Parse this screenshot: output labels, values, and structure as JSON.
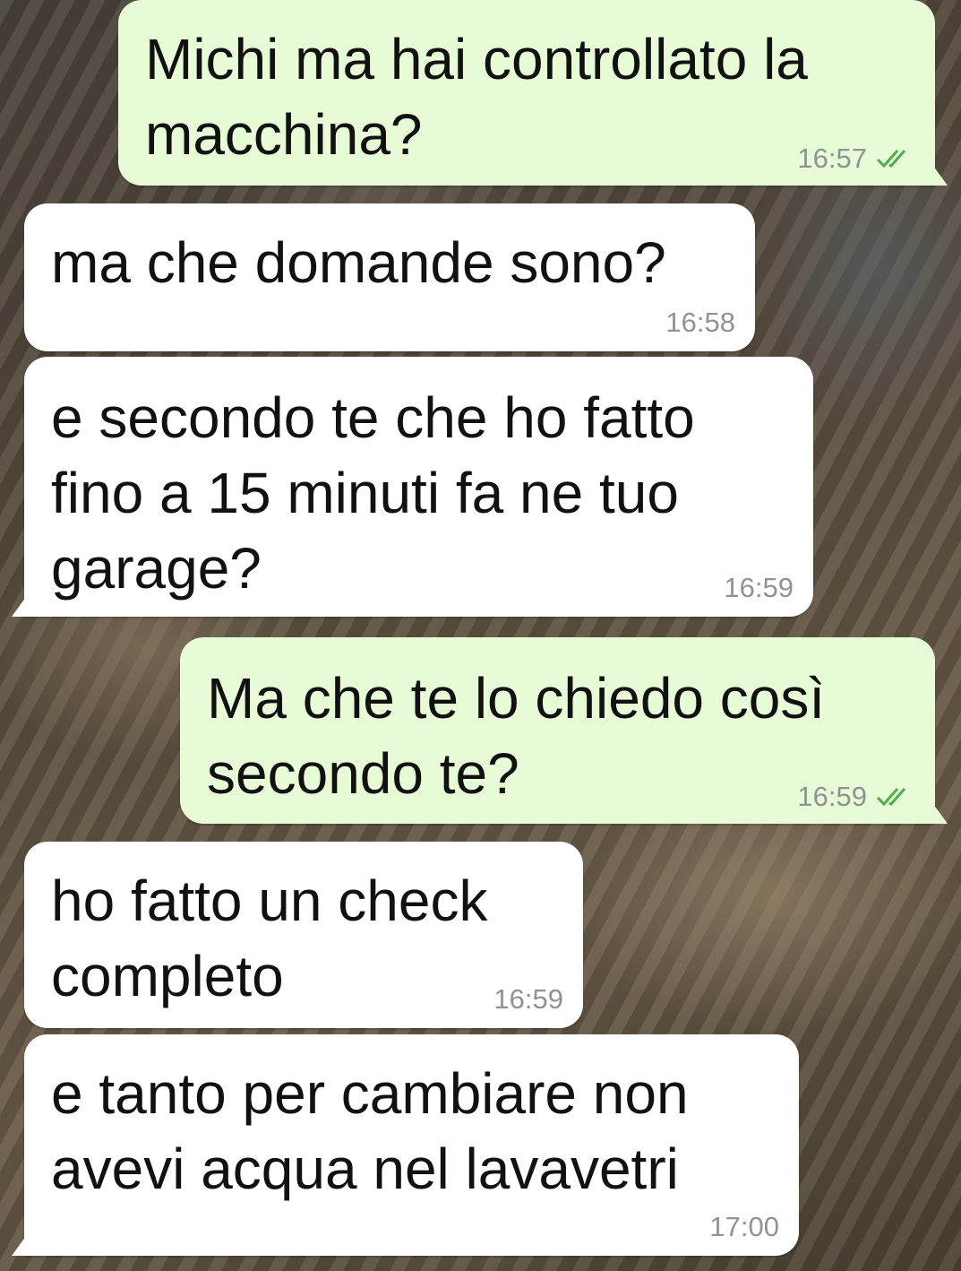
{
  "messages": [
    {
      "direction": "outgoing",
      "text": "Michi ma hai controllato la\nmacchina?",
      "time": "16:57",
      "status_icon": "double-check-icon"
    },
    {
      "direction": "incoming",
      "text": "ma che domande sono?",
      "time": "16:58"
    },
    {
      "direction": "incoming",
      "text": "e secondo te che ho fatto\nfino a 15 minuti fa ne tuo\ngarage?",
      "time": "16:59"
    },
    {
      "direction": "outgoing",
      "text": "Ma che te lo chiedo così\nsecondo te?",
      "time": "16:59",
      "status_icon": "double-check-icon"
    },
    {
      "direction": "incoming",
      "text": "ho fatto un check\ncompleto",
      "time": "16:59"
    },
    {
      "direction": "incoming",
      "text": "e tanto per cambiare non\navevi acqua nel lavavetri",
      "time": "17:00"
    }
  ],
  "colors": {
    "incoming_bubble": "#ffffff",
    "outgoing_bubble": "#e7fbd7",
    "timestamp": "#8f9493",
    "read_ticks": "#4fae4e"
  }
}
